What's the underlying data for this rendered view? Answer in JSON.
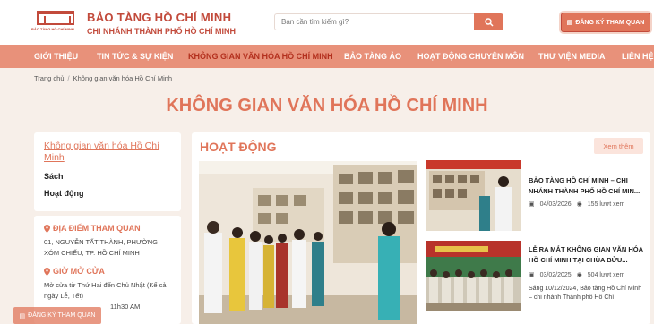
{
  "header": {
    "logo_caption": "BẢO TÀNG HỒ CHÍ MINH",
    "brand_title": "BẢO TÀNG HỒ CHÍ MINH",
    "brand_subtitle": "CHI NHÁNH THÀNH PHỐ HỒ CHÍ MINH",
    "search_placeholder": "Bạn cần tìm kiếm gì?",
    "search_icon": "search-icon",
    "register_label": "ĐĂNG KÝ THAM QUAN"
  },
  "nav": {
    "items": [
      "GIỚI THIỆU",
      "TIN TỨC & SỰ KIỆN",
      "KHÔNG GIAN VĂN HÓA HỒ CHÍ MINH",
      "BẢO TÀNG ẢO",
      "HOẠT ĐỘNG CHUYÊN MÔN",
      "THƯ VIỆN MEDIA",
      "LIÊN HỆ"
    ],
    "active_index": 2
  },
  "breadcrumb": {
    "home": "Trang chủ",
    "sep": "/",
    "current": "Không gian văn hóa Hồ Chí Minh"
  },
  "page_title": "KHÔNG GIAN VĂN HÓA HỒ CHÍ MINH",
  "sidebar": {
    "menu": [
      "Không gian văn hóa Hồ Chí Minh",
      "Sách",
      "Hoạt động"
    ],
    "location_heading": "ĐỊA ĐIỂM THAM QUAN",
    "location_text": "01, NGUYỄN TẤT THÀNH, PHƯỜNG XÓM CHIẾU, TP. HỒ CHÍ MINH",
    "hours_heading": "GIỜ MỞ CỬA",
    "hours_text": "Mở cửa từ Thứ Hai đến Chủ Nhật (Kể cả ngày Lễ, Tết)",
    "hours_time": "11h30 AM"
  },
  "main": {
    "title": "HOẠT ĐỘNG",
    "see_more": "Xem thêm",
    "news": [
      {
        "title": "BẢO TÀNG HỒ CHÍ MINH – CHI NHÁNH THÀNH PHỐ HỒ CHÍ MIN...",
        "date": "04/03/2026",
        "views": "155 lượt xem",
        "summary": ""
      },
      {
        "title": "LỄ RA MẮT KHÔNG GIAN VĂN HÓA HỒ CHÍ MINH TẠI CHÙA BỬU...",
        "date": "03/02/2025",
        "views": "504 lượt xem",
        "summary": "Sáng 10/12/2024, Bảo tàng Hồ Chí Minh – chi nhánh Thành phố Hồ Chí"
      }
    ]
  },
  "floating_register": "ĐĂNG KÝ THAM QUAN",
  "colors": {
    "accent": "#e0755a",
    "nav": "#e8917a",
    "active_nav": "#b3301e",
    "background": "#f7efe9"
  }
}
